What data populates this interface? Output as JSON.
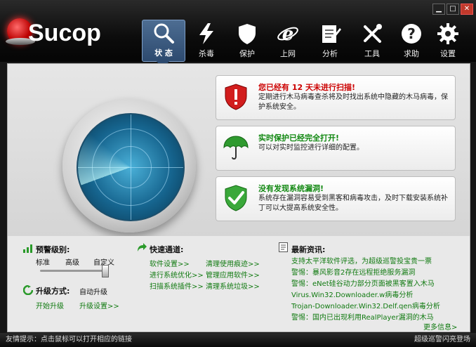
{
  "app": {
    "name": "Sucop"
  },
  "window_controls": {
    "minimize": "▁",
    "maximize": "□",
    "close": "✕"
  },
  "nav": [
    {
      "id": "status",
      "label": "状 态",
      "icon": "magnifier-icon"
    },
    {
      "id": "antivirus",
      "label": "杀毒",
      "icon": "lightning-icon"
    },
    {
      "id": "protect",
      "label": "保护",
      "icon": "shield-icon"
    },
    {
      "id": "internet",
      "label": "上网",
      "icon": "browser-icon"
    },
    {
      "id": "analysis",
      "label": "分析",
      "icon": "notepad-icon"
    },
    {
      "id": "tools",
      "label": "工具",
      "icon": "wrench-icon"
    },
    {
      "id": "help",
      "label": "求助",
      "icon": "help-icon"
    },
    {
      "id": "settings",
      "label": "设置",
      "icon": "gear-icon"
    }
  ],
  "cards": [
    {
      "title": "您已经有 12 天未进行扫描!",
      "body": "定期进行木马病毒查杀将及时找出系统中隐藏的木马病毒，保护系统安全。",
      "title_color": "#cc0000",
      "icon": "danger-shield-icon"
    },
    {
      "title": "实时保护已经完全打开!",
      "body": "可以对实时监控进行详细的配置。",
      "title_color": "#118811",
      "icon": "umbrella-icon"
    },
    {
      "title": "没有发现系统漏洞!",
      "body": "系统存在漏洞容易受到黑客和病毒攻击，及时下载安装系统补丁可以大提高系统安全性。",
      "title_color": "#118811",
      "icon": "safe-shield-icon"
    }
  ],
  "alert_level": {
    "heading": "预警级别:",
    "levels": [
      "标准",
      "高级",
      "自定义"
    ],
    "current": "自定义"
  },
  "upgrade": {
    "heading": "升级方式:",
    "value": "自动升级",
    "links": [
      "开始升级",
      "升级设置>>"
    ]
  },
  "quick": {
    "heading": "快速通道:",
    "links": [
      "软件设置>>",
      "清理使用痕迹>>",
      "进行系统优化>>",
      "管理应用软件>>",
      "扫描系统插件>>",
      "清理系统垃圾>>"
    ]
  },
  "news": {
    "heading": "最新资讯:",
    "items": [
      "支持太平洋软件评选，为超级巡警投宝贵一票",
      "警惕：暴风影音2存在远程拒绝服务漏洞",
      "警惕：eNet硅谷动力部分页面被黑客置入木马",
      "Virus.Win32.Downloader.w病毒分析",
      "Trojan-Downloader.Win32.Delf.qen病毒分析",
      "警惕：国内已出现利用RealPlayer漏洞的木马"
    ],
    "more": "更多信息>"
  },
  "statusbar": {
    "tip": "友情提示：点击鼠标可以打开相应的链接",
    "brand": "超级巡警闪亮登场"
  },
  "colors": {
    "link": "#117a11",
    "accent": "#2d4a6f"
  }
}
